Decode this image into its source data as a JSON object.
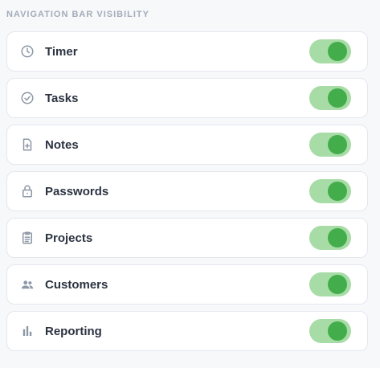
{
  "section": {
    "title": "NAVIGATION BAR VISIBILITY"
  },
  "items": [
    {
      "label": "Timer",
      "icon": "clock-icon",
      "enabled": true
    },
    {
      "label": "Tasks",
      "icon": "check-circle-icon",
      "enabled": true
    },
    {
      "label": "Notes",
      "icon": "note-add-icon",
      "enabled": true
    },
    {
      "label": "Passwords",
      "icon": "lock-icon",
      "enabled": true
    },
    {
      "label": "Projects",
      "icon": "clipboard-icon",
      "enabled": true
    },
    {
      "label": "Customers",
      "icon": "people-icon",
      "enabled": true
    },
    {
      "label": "Reporting",
      "icon": "bar-chart-icon",
      "enabled": true
    }
  ],
  "colors": {
    "toggle_track_on": "#a7dca6",
    "toggle_knob_on": "#43ad4b",
    "icon": "#8d97a6",
    "label": "#2b3341",
    "section_title": "#a3acb9"
  }
}
